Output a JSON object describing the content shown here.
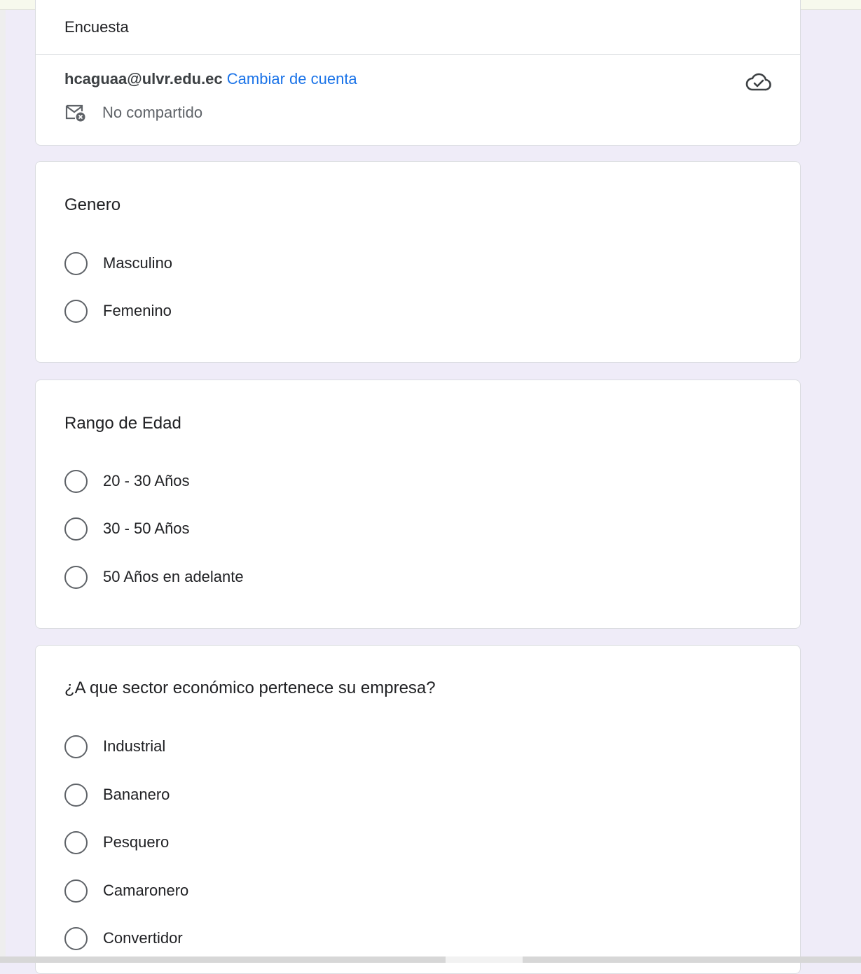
{
  "header": {
    "title": "Encuesta",
    "account_email": "hcaguaa@ulvr.edu.ec",
    "switch_account": "Cambiar de cuenta",
    "shared_status": "No compartido"
  },
  "questions": [
    {
      "title": "Genero",
      "options": [
        "Masculino",
        "Femenino"
      ]
    },
    {
      "title": "Rango de Edad",
      "options": [
        "20 - 30 Años",
        "30 - 50 Años",
        "50 Años en adelante"
      ]
    },
    {
      "title": "¿A que sector económico pertenece su empresa?",
      "options": [
        "Industrial",
        "Bananero",
        "Pesquero",
        "Camaronero",
        "Convertidor"
      ]
    }
  ],
  "colors": {
    "background": "#efecf8",
    "link": "#1a73e8",
    "card": "#ffffff"
  },
  "icons": {
    "cloud": "cloud-check-icon",
    "mail": "mail-not-shared-icon"
  }
}
